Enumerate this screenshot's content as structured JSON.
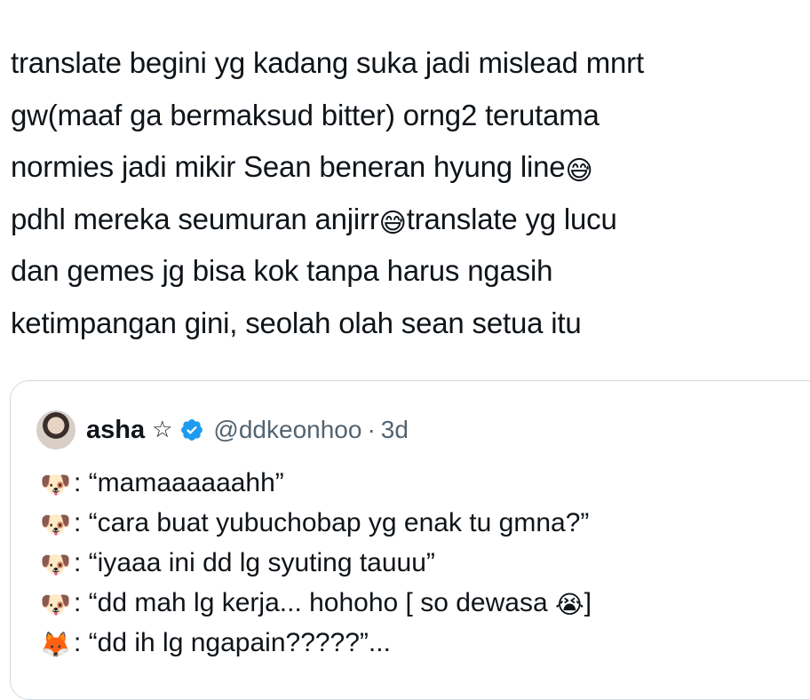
{
  "tweet": {
    "lines": [
      {
        "text": "translate begini yg kadang suka jadi mislead mnrt",
        "after_emoji": "",
        "after_text": ""
      },
      {
        "text": "gw(maaf ga bermaksud bitter) orng2 terutama",
        "after_emoji": "",
        "after_text": ""
      },
      {
        "text": "normies jadi mikir Sean beneran hyung line",
        "after_emoji": "😅",
        "after_text": ""
      },
      {
        "text": "pdhl mereka seumuran anjirr",
        "after_emoji": "😅",
        "after_text": "translate yg lucu"
      },
      {
        "text": "dan gemes jg bisa kok tanpa harus ngasih",
        "after_emoji": "",
        "after_text": ""
      },
      {
        "text": "ketimpangan gini, seolah olah sean setua itu",
        "after_emoji": "",
        "after_text": ""
      }
    ]
  },
  "quote": {
    "display_name": "asha",
    "name_symbol": "☆",
    "handle": "@ddkeonhoo",
    "separator": "·",
    "time": "3d",
    "verified_color": "#1d9bf0",
    "lines": [
      {
        "emoji": "🐶",
        "text": ": “mamaaaaaahh”",
        "trail_emoji": "",
        "trail_text": ""
      },
      {
        "emoji": "🐶",
        "text": ": “cara buat yubuchobap yg enak tu gmna?”",
        "trail_emoji": "",
        "trail_text": ""
      },
      {
        "emoji": "🐶",
        "text": ": “iyaaa ini dd lg syuting tauuu”",
        "trail_emoji": "",
        "trail_text": ""
      },
      {
        "emoji": "🐶",
        "text": ": “dd mah lg kerja... hohoho [ so dewasa ",
        "trail_emoji": "😭",
        "trail_text": "]"
      },
      {
        "emoji": "🦊",
        "text": ": “dd ih lg ngapain?????”...",
        "trail_emoji": "",
        "trail_text": ""
      }
    ]
  }
}
